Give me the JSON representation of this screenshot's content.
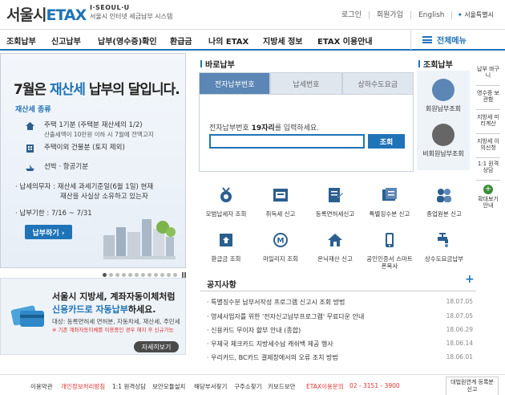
{
  "header": {
    "logo_kor": "서울시",
    "logo_etax": "ETAX",
    "logo_sub1": "I·SEOUL·U",
    "logo_sub2": "서울시 인터넷 세금납부 시스템",
    "links": [
      "로그인",
      "회원가입",
      "English"
    ],
    "seoul_badge": "서울특별시"
  },
  "nav": {
    "items": [
      "조회납부",
      "신고납부",
      "납부(영수증)확인",
      "환급금",
      "나의 ETAX",
      "지방세 정보",
      "ETAX 이용안내"
    ],
    "all_menu": "전체메뉴"
  },
  "banner": {
    "title_pre": "7월은",
    "title_hl": "재산세",
    "title_post": "납부의 달입니다.",
    "kinds_title": "재산세 종류",
    "kinds": [
      {
        "txt": "주택 1기분 (주택분 재산세의 1/2)",
        "sub": "산출세액이 10만원 이하 시 7월에 전액고지"
      },
      {
        "txt": "주택이외 건물분 (토지 제외)",
        "sub": ""
      },
      {
        "txt": "선박 · 항공기분",
        "sub": ""
      }
    ],
    "obligor_line1": "· 납세의무자 : 재산세 과세기준일(6월 1일) 현재",
    "obligor_line2": "재산을 사실상 소유하고 있는자",
    "due": "· 납부기한 : 7/16 ~ 7/31",
    "pay_btn": "납부하기 ›"
  },
  "promo": {
    "line1": "서울시 지방세, 계좌자동이체처럼",
    "line2_hl": "신용카드로 자동납부",
    "line2_post": "하세요.",
    "small1": "대상: 등록면허세 면허분, 자동차세, 재산세, 주민세",
    "small2": "※ 기존 계좌자동이체를 이용중인 경우 해지 후 신규가능",
    "btn": "자세히보기"
  },
  "direct": {
    "title": "바로납부",
    "tabs": [
      "전자납부번호",
      "납세번호",
      "상하수도요금"
    ],
    "label_pre": "전자납부번호",
    "label_bold": "19자리",
    "label_post": "를 입력하세요.",
    "input_value": "",
    "btn": "조회"
  },
  "services": [
    {
      "icon": "medal-icon",
      "label": "모범납세자 조회"
    },
    {
      "icon": "register-icon",
      "label": "취득세 신고"
    },
    {
      "icon": "document-icon",
      "label": "등록면허세신고"
    },
    {
      "icon": "report-icon",
      "label": "특별징수분 신고"
    },
    {
      "icon": "people-icon",
      "label": "종업원분 신고"
    },
    {
      "icon": "refund-icon",
      "label": "환급금 조회"
    },
    {
      "icon": "mileage-icon",
      "label": "마일리지 조회"
    },
    {
      "icon": "house-icon",
      "label": "온닉재산 신고"
    },
    {
      "icon": "phone-icon",
      "label": "공인인증서 스마트폰복사"
    },
    {
      "icon": "faucet-icon",
      "label": "상수도요금납부"
    }
  ],
  "lookup": {
    "title": "조회납부",
    "items": [
      "회원납부조회",
      "비회원납부조회"
    ]
  },
  "quick": {
    "items": [
      "납부 바구니",
      "영수증 보관함",
      "지방세 미리계산",
      "지방세 이의신청",
      "1:1 원격 상담"
    ],
    "more": "확대보기 안내"
  },
  "notice": {
    "title": "공지사항",
    "items": [
      {
        "title": "특별징수분 납부서작성 프로그램 신고시 조회 방법",
        "date": "18.07.05"
      },
      {
        "title": "영세사업자를 위한 '전자신고납부프로그램' 무료다운 안내",
        "date": "18.07.05"
      },
      {
        "title": "신용카드 무이자 할부 안내 (종합)",
        "date": "18.06.29"
      },
      {
        "title": "우체국 체크카드 지방세수납 캐쉬백 제공 행사",
        "date": "18.06.14"
      },
      {
        "title": "우리카드, BC카드 결제창에서의 오류 조치 방법",
        "date": "18.06.01"
      }
    ]
  },
  "footer": {
    "links": [
      "이용약관",
      "개인정보처리방침",
      "1:1 원격상담",
      "보안모듈설치",
      "해당부서찾기",
      "구주소찾기",
      "키보드보안",
      "ETAX이용문의",
      "02 - 3151 - 3900"
    ],
    "side": "대법원연계 등록분신고"
  }
}
